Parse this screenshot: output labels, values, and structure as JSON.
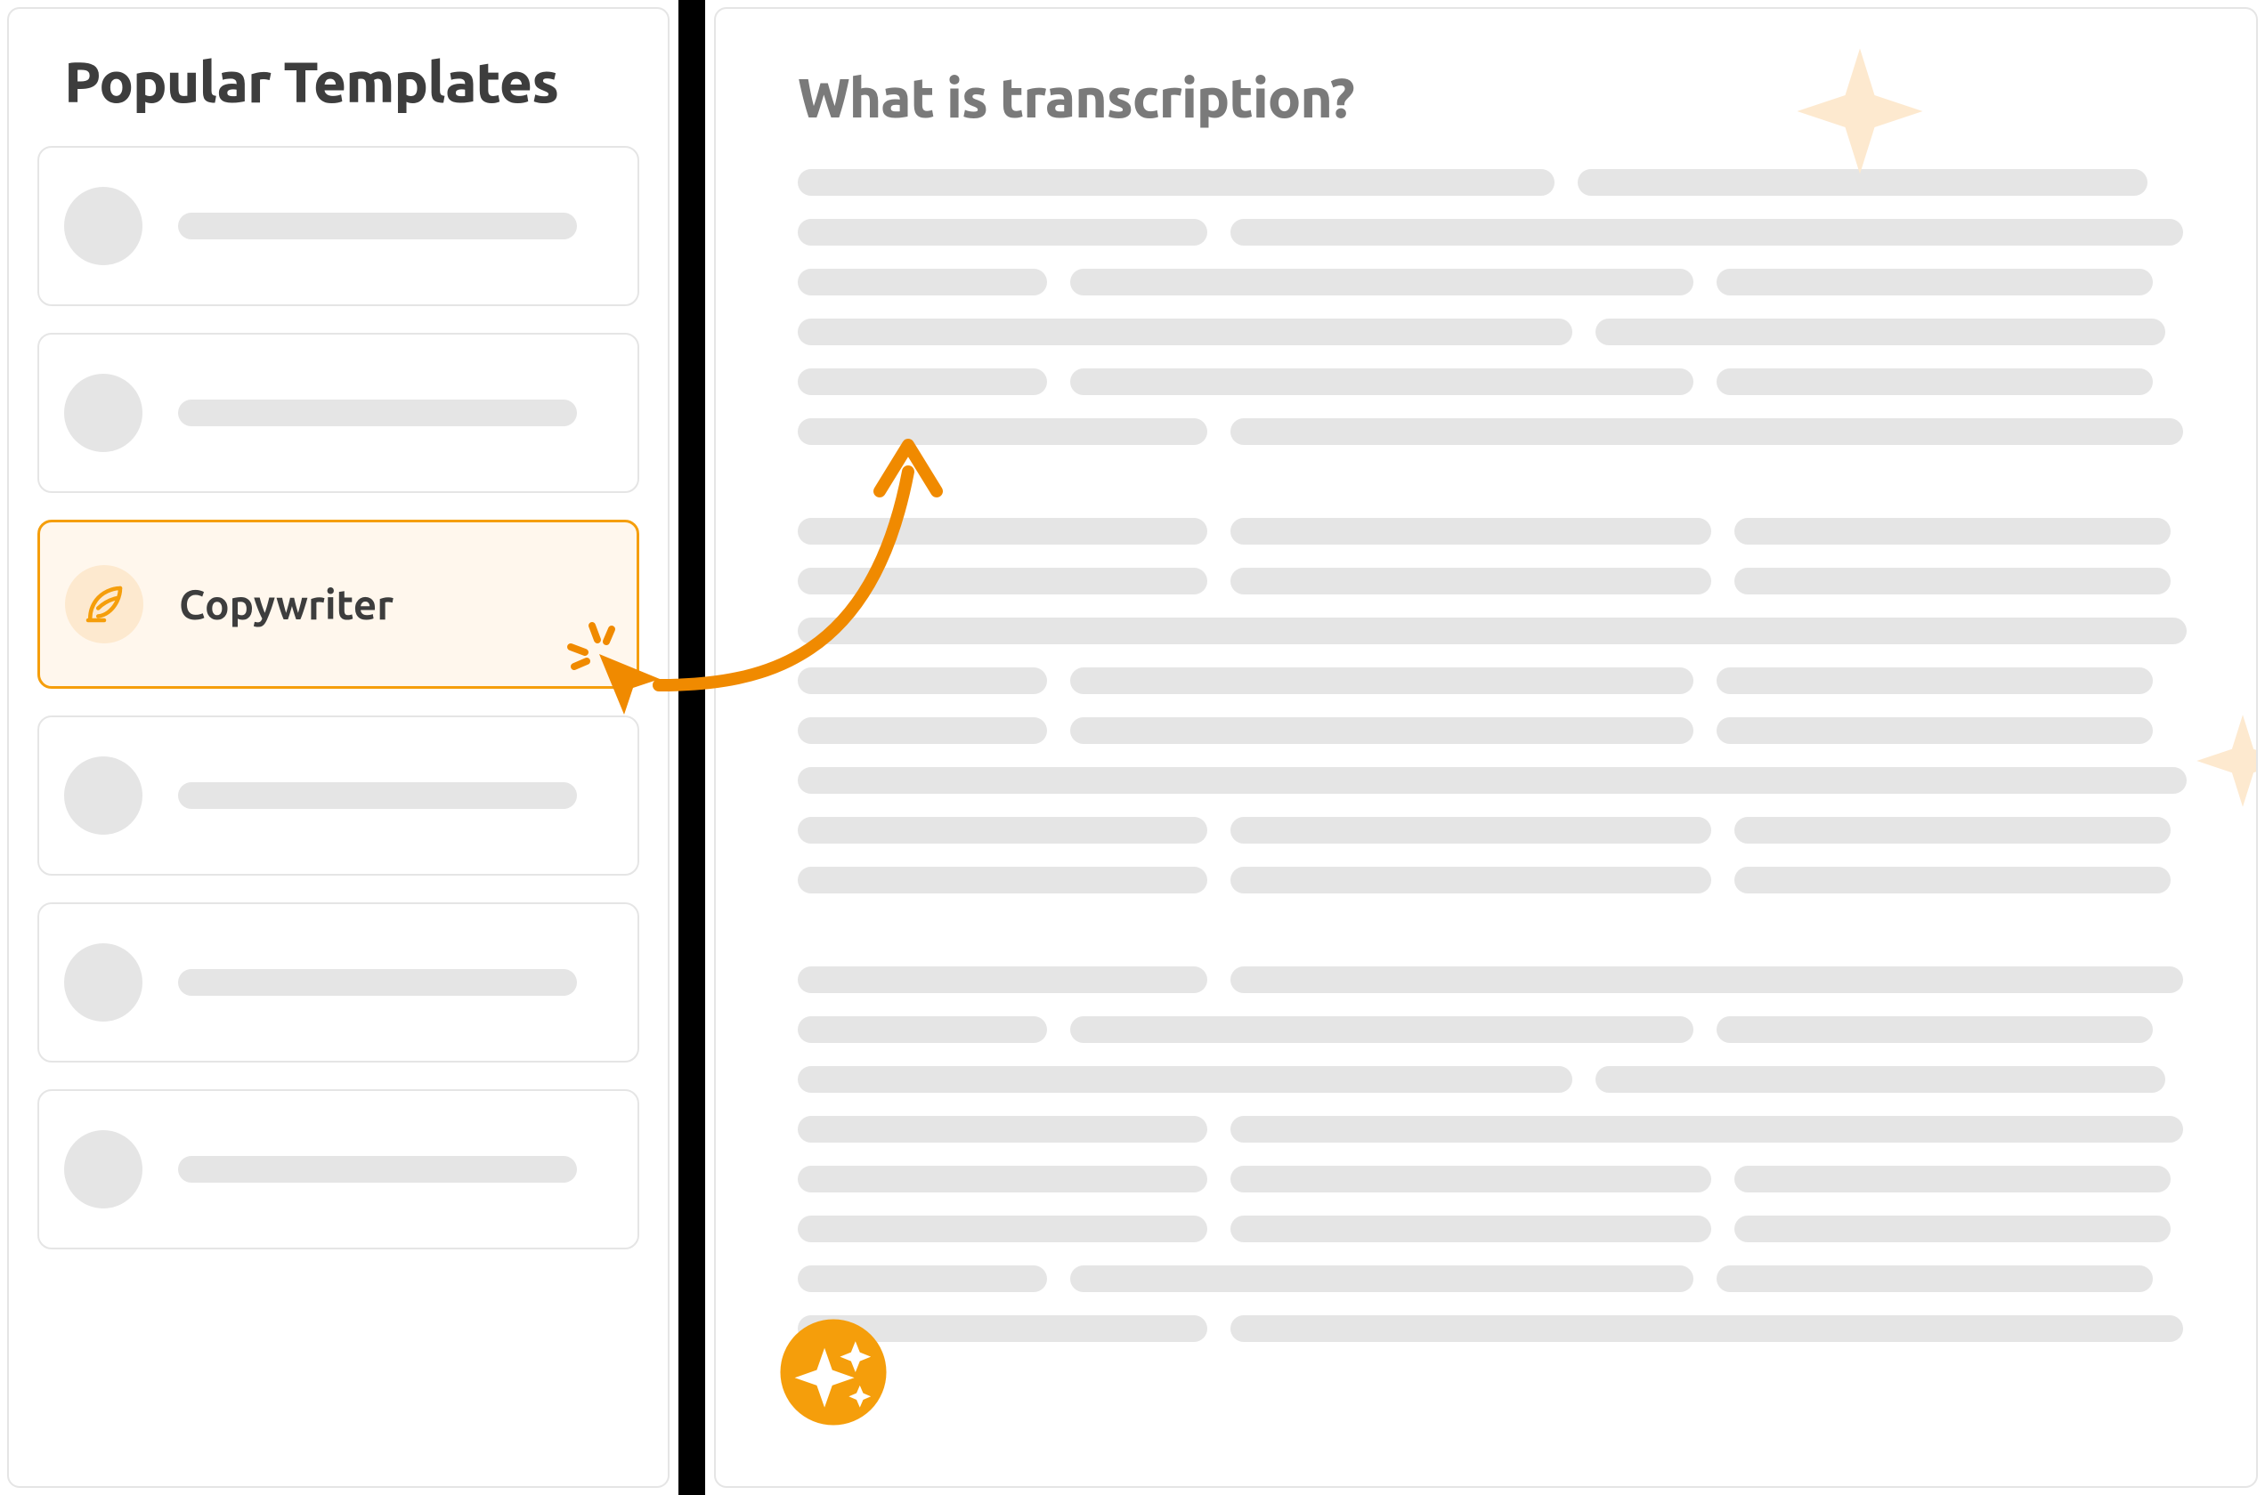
{
  "sidebar": {
    "title": "Popular Templates",
    "items": [
      {
        "label": "",
        "selected": false
      },
      {
        "label": "",
        "selected": false
      },
      {
        "label": "Copywriter",
        "selected": true,
        "icon": "feather-icon"
      },
      {
        "label": "",
        "selected": false
      },
      {
        "label": "",
        "selected": false
      },
      {
        "label": "",
        "selected": false
      }
    ]
  },
  "main": {
    "title": "What is transcription?"
  },
  "colors": {
    "accent": "#f59e0b",
    "accent_deep": "#f08a00",
    "highlight_bg": "#fff7ed",
    "placeholder": "#e5e5e5",
    "text_dark": "#3d3d3d",
    "text_muted": "#7a7a7a",
    "pale_star": "#fde9cf"
  }
}
